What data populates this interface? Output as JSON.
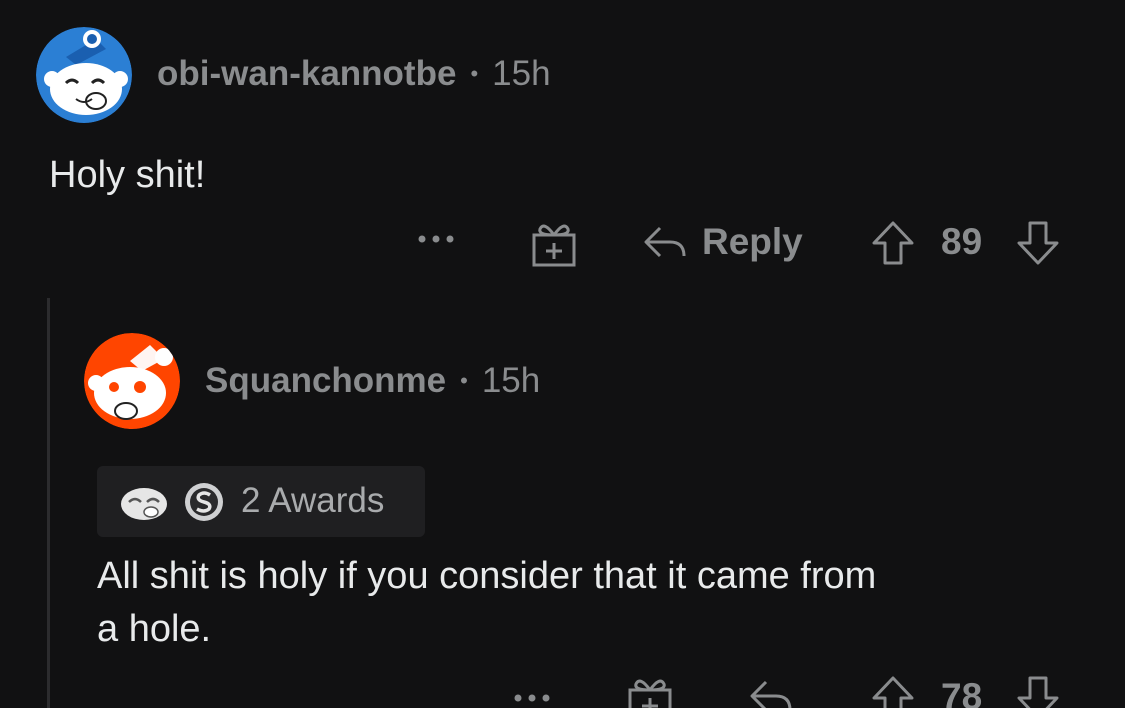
{
  "comments": [
    {
      "username": "obi-wan-kannotbe",
      "separator": "•",
      "time": "15h",
      "body": "Holy shit!",
      "reply_label": "Reply",
      "score": "89",
      "avatar_color": "#2b7fd4"
    },
    {
      "username": "Squanchonme",
      "separator": "•",
      "time": "15h",
      "awards_label": "2 Awards",
      "body_line1": "All shit is holy if you consider that it came from",
      "body_line2": "a hole.",
      "score": "78",
      "avatar_color": "#ff4500"
    }
  ],
  "icons": {
    "more": "more-options-icon",
    "award": "gift-award-icon",
    "reply": "reply-arrow-icon",
    "upvote": "upvote-arrow-icon",
    "downvote": "downvote-arrow-icon"
  },
  "colors": {
    "background": "#111112",
    "text": "#e8eaeb",
    "muted": "#8a8c8e"
  }
}
